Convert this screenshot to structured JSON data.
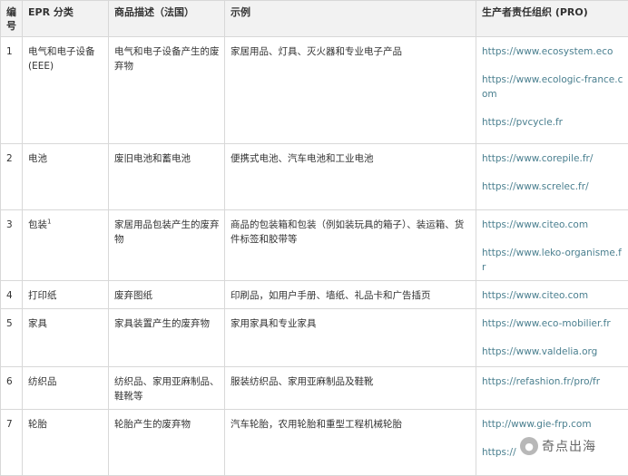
{
  "table": {
    "headers": [
      "编号",
      "EPR 分类",
      "商品描述（法国）",
      "示例",
      "生产者责任组织 (PRO)"
    ],
    "rows": [
      {
        "no": "1",
        "category": "电气和电子设备 (EEE)",
        "sup": "",
        "desc": "电气和电子设备产生的废弃物",
        "example": "家居用品、灯具、灭火器和专业电子产品",
        "pro": [
          "https://www.ecosystem.eco",
          "https://www.ecologic-france.com",
          "https://pvcycle.fr"
        ]
      },
      {
        "no": "2",
        "category": "电池",
        "sup": "",
        "desc": "废旧电池和蓄电池",
        "example": "便携式电池、汽车电池和工业电池",
        "pro": [
          "https://www.corepile.fr/",
          "https://www.screlec.fr/"
        ]
      },
      {
        "no": "3",
        "category": "包装",
        "sup": "1",
        "desc": "家居用品包装产生的废弃物",
        "example": "商品的包装箱和包装（例如装玩具的箱子）、装运箱、货件标签和胶带等",
        "pro": [
          "https://www.citeo.com",
          "https://www.leko-organisme.fr"
        ]
      },
      {
        "no": "4",
        "category": "打印纸",
        "sup": "",
        "desc": "废弃图纸",
        "example": "印刷品，如用户手册、墙纸、礼品卡和广告插页",
        "pro": [
          "https://www.citeo.com"
        ]
      },
      {
        "no": "5",
        "category": "家具",
        "sup": "",
        "desc": "家具装置产生的废弃物",
        "example": "家用家具和专业家具",
        "pro": [
          "https://www.eco-mobilier.fr",
          "https://www.valdelia.org"
        ]
      },
      {
        "no": "6",
        "category": "纺织品",
        "sup": "",
        "desc": "纺织品、家用亚麻制品、鞋靴等",
        "example": "服装纺织品、家用亚麻制品及鞋靴",
        "pro": [
          "https://refashion.fr/pro/fr"
        ]
      },
      {
        "no": "7",
        "category": "轮胎",
        "sup": "",
        "desc": "轮胎产生的废弃物",
        "example": "汽车轮胎，农用轮胎和重型工程机械轮胎",
        "pro": [
          "http://www.gie-frp.com",
          "https://"
        ]
      }
    ]
  },
  "watermark": {
    "text": "奇点出海",
    "icon": "wechat-official-account-icon"
  }
}
